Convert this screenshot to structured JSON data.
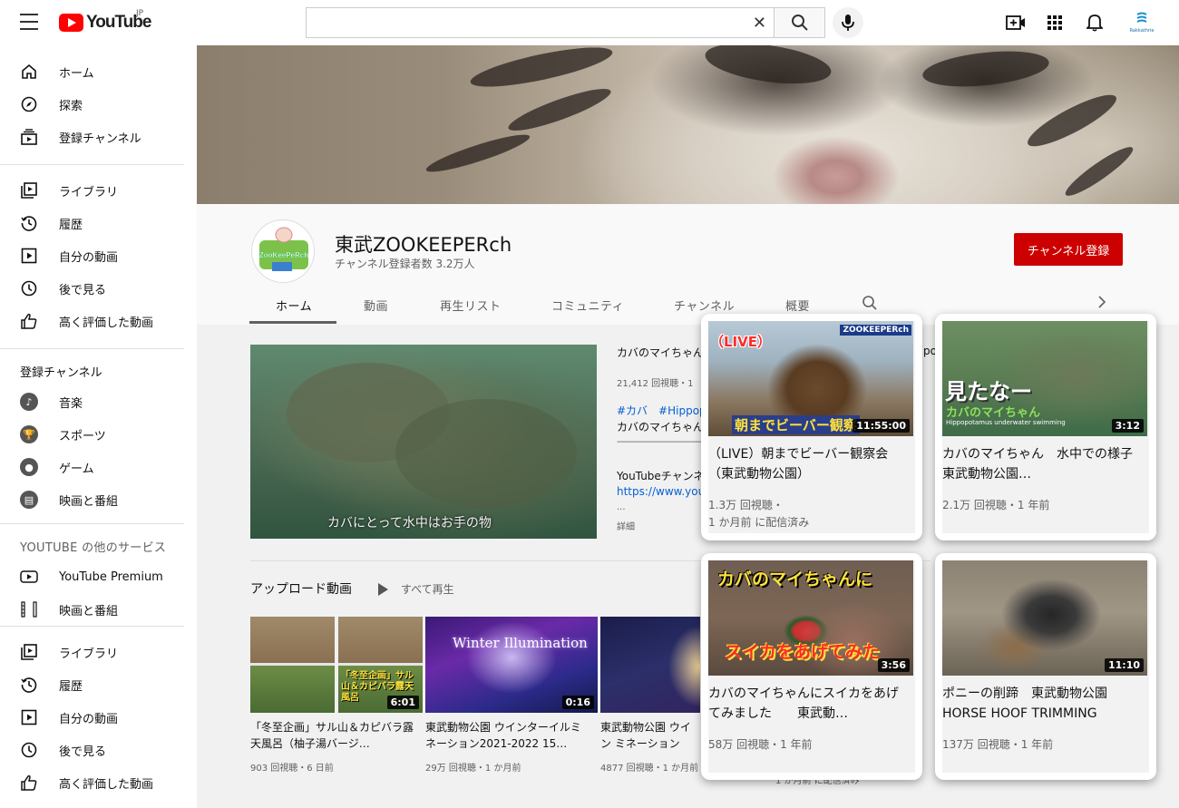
{
  "topbar": {
    "logo_text": "YouTube",
    "region": "JP",
    "search_value": "",
    "account_label": "Rakkathrie"
  },
  "sidebar": {
    "main": [
      {
        "label": "ホーム",
        "icon": "home-icon"
      },
      {
        "label": "探索",
        "icon": "explore-icon"
      },
      {
        "label": "登録チャンネル",
        "icon": "subscriptions-icon"
      }
    ],
    "library": [
      {
        "label": "ライブラリ",
        "icon": "library-icon"
      },
      {
        "label": "履歴",
        "icon": "history-icon"
      },
      {
        "label": "自分の動画",
        "icon": "your-videos-icon"
      },
      {
        "label": "後で見る",
        "icon": "watch-later-icon"
      },
      {
        "label": "高く評価した動画",
        "icon": "liked-videos-icon"
      }
    ],
    "subscriptions_heading": "登録チャンネル",
    "subscriptions": [
      {
        "label": "音楽",
        "icon": "music-icon"
      },
      {
        "label": "スポーツ",
        "icon": "sports-icon"
      },
      {
        "label": "ゲーム",
        "icon": "gaming-icon"
      },
      {
        "label": "映画と番組",
        "icon": "movies-icon"
      }
    ],
    "more_heading": "YOUTUBE の他のサービス",
    "more": [
      {
        "label": "YouTube Premium",
        "icon": "premium-icon"
      },
      {
        "label": "映画と番組",
        "icon": "movies-icon"
      }
    ],
    "library2": [
      {
        "label": "ライブラリ",
        "icon": "library-icon"
      },
      {
        "label": "履歴",
        "icon": "history-icon"
      },
      {
        "label": "自分の動画",
        "icon": "your-videos-icon"
      },
      {
        "label": "後で見る",
        "icon": "watch-later-icon"
      },
      {
        "label": "高く評価した動画",
        "icon": "liked-videos-icon"
      }
    ]
  },
  "channel": {
    "name": "東武ZOOKEEPERch",
    "subscribers": "チャンネル登録者数 3.2万人",
    "subscribe_label": "チャンネル登録",
    "avatar_text": "ZooKeePeRch",
    "tabs": [
      "ホーム",
      "動画",
      "再生リスト",
      "コミュニティ",
      "チャンネル",
      "概要"
    ]
  },
  "featured": {
    "caption": "カバにとって水中はお手の物",
    "title": "カバのマイちゃん",
    "meta": "21,412 回視聴・1",
    "tags": "#カバ　#Hippop",
    "line2": "カバのマイちゃん",
    "divider": "------------------------------------------------------------",
    "line3": "YouTubeチャンネ",
    "link": "https://www.you",
    "ellipsis": "...",
    "details": "詳細",
    "partial_right": "po"
  },
  "uploads": {
    "title": "アップロード動画",
    "play_all": "すべて再生",
    "videos": [
      {
        "title": "「冬至企画」サル山＆カピバラ露天風呂（柚子湯バージ…",
        "meta": "903 回視聴・6 日前",
        "duration": "6:01",
        "thumb_text": "「冬至企画」サル山＆カピバラ露天風呂"
      },
      {
        "title": "東武動物公園 ウインターイルミネーション2021-2022 15…",
        "meta": "29万 回視聴・1 か月前",
        "duration": "0:16",
        "thumb_text": "Winter Illumination"
      },
      {
        "title": "東武動物公園 ウイン ミネーション2021-",
        "meta": "4877 回視聴・1 か月前",
        "duration": ""
      }
    ],
    "hidden_meta": "1 か月前 に配信済み"
  },
  "cards": [
    {
      "title": "（LIVE）朝までビーバー観察会　（東武動物公園）",
      "meta1": "1.3万 回視聴・",
      "meta2": "1 か月前 に配信済み",
      "duration": "11:55:00",
      "thumb_text": "朝までビーバー観察",
      "badge": "（LIVE）",
      "corner": "ZOOKEEPERch"
    },
    {
      "title": "カバのマイちゃん　水中での様子　　東武動物公園…",
      "meta1": "2.1万 回視聴・1 年前",
      "meta2": "",
      "duration": "3:12",
      "thumb_text": "見たなー",
      "thumb_sub": "カバのマイちゃん",
      "thumb_sub2": "Hippopotamus underwater swimming"
    },
    {
      "title": "カバのマイちゃんにスイカをあげてみました　　東武動…",
      "meta1": "58万 回視聴・1 年前",
      "meta2": "",
      "duration": "3:56",
      "thumb_text": "カバのマイちゃんに",
      "thumb_text2": "スイカをあげてみた"
    },
    {
      "title": "ポニーの削蹄　東武動物公園 HORSE HOOF TRIMMING",
      "meta1": "137万 回視聴・1 年前",
      "meta2": "",
      "duration": "11:10"
    }
  ],
  "colors": {
    "brand_red": "#ff0000",
    "subscribe_red": "#cc0000",
    "link_blue": "#065fd4"
  }
}
